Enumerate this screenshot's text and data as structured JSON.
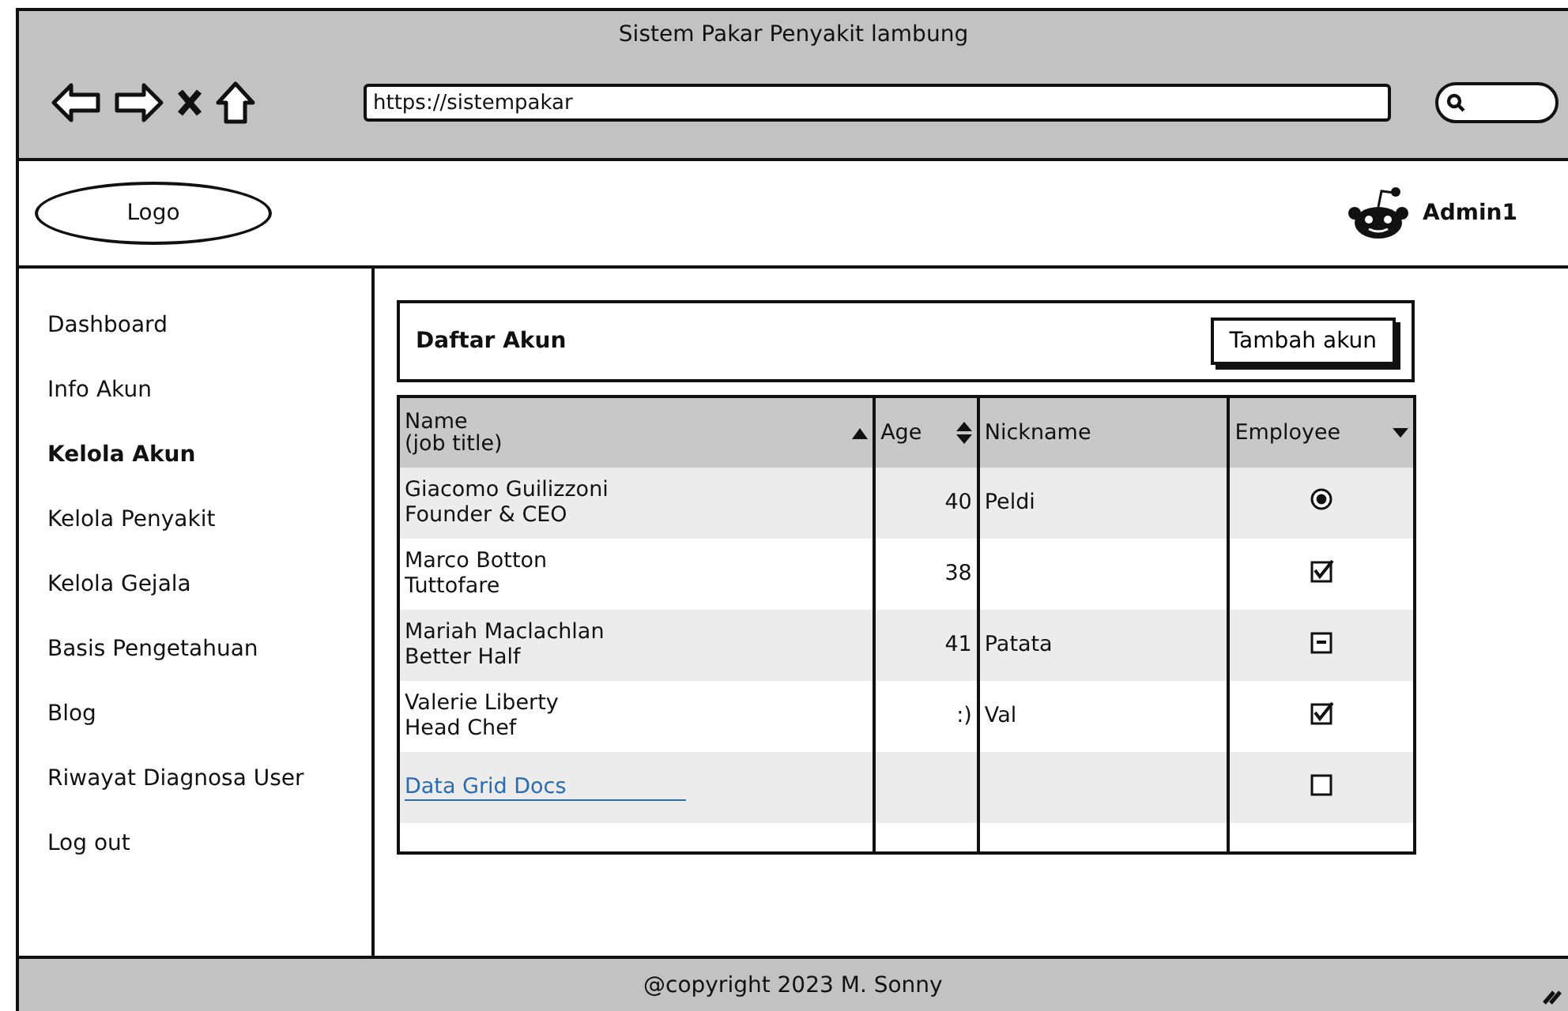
{
  "browser": {
    "title": "Sistem Pakar Penyakit lambung",
    "url": "https://sistempakar"
  },
  "navbar": {
    "logo": "Logo",
    "user": "Admin1"
  },
  "sidebar": {
    "items": [
      {
        "label": "Dashboard",
        "selected": false
      },
      {
        "label": "Info Akun",
        "selected": false
      },
      {
        "label": "Kelola Akun",
        "selected": true
      },
      {
        "label": "Kelola Penyakit",
        "selected": false
      },
      {
        "label": "Kelola Gejala",
        "selected": false
      },
      {
        "label": "Basis Pengetahuan",
        "selected": false
      },
      {
        "label": "Blog",
        "selected": false
      },
      {
        "label": "Riwayat Diagnosa User",
        "selected": false
      },
      {
        "label": "Log out",
        "selected": false
      }
    ]
  },
  "panel": {
    "title": "Daftar Akun",
    "button": "Tambah akun"
  },
  "table": {
    "columns": [
      {
        "label": "Name",
        "sublabel": "(job title)",
        "kind": "sorted"
      },
      {
        "label": "Age",
        "kind": "sortable"
      },
      {
        "label": "Nickname",
        "kind": "plain"
      },
      {
        "label": "Employee",
        "kind": "menu"
      }
    ],
    "rows": [
      {
        "kind": "person",
        "name": "Giacomo Guilizzoni",
        "job_title": "Founder & CEO",
        "age": "40",
        "nickname": "Peldi",
        "employee": {
          "kind": "radio",
          "checked": true,
          "indeterminate": false
        }
      },
      {
        "kind": "person",
        "name": "Marco Botton",
        "job_title": "Tuttofare",
        "age": "38",
        "employee": {
          "kind": "checkbox",
          "checked": true,
          "indeterminate": false
        }
      },
      {
        "kind": "person",
        "name": "Mariah Maclachlan",
        "job_title": "Better Half",
        "age": "41",
        "nickname": "Patata",
        "employee": {
          "kind": "checkbox",
          "checked": false,
          "indeterminate": true
        }
      },
      {
        "kind": "person",
        "name": "Valerie Liberty",
        "job_title": "Head Chef",
        "age": ":)",
        "nickname": "Val",
        "employee": {
          "kind": "checkbox",
          "checked": true,
          "indeterminate": false
        }
      },
      {
        "kind": "link",
        "name": "Data Grid Docs",
        "employee": {
          "kind": "checkbox",
          "checked": false,
          "indeterminate": false
        }
      }
    ]
  },
  "footer": {
    "text": "@copyright 2023 M. Sonny"
  }
}
